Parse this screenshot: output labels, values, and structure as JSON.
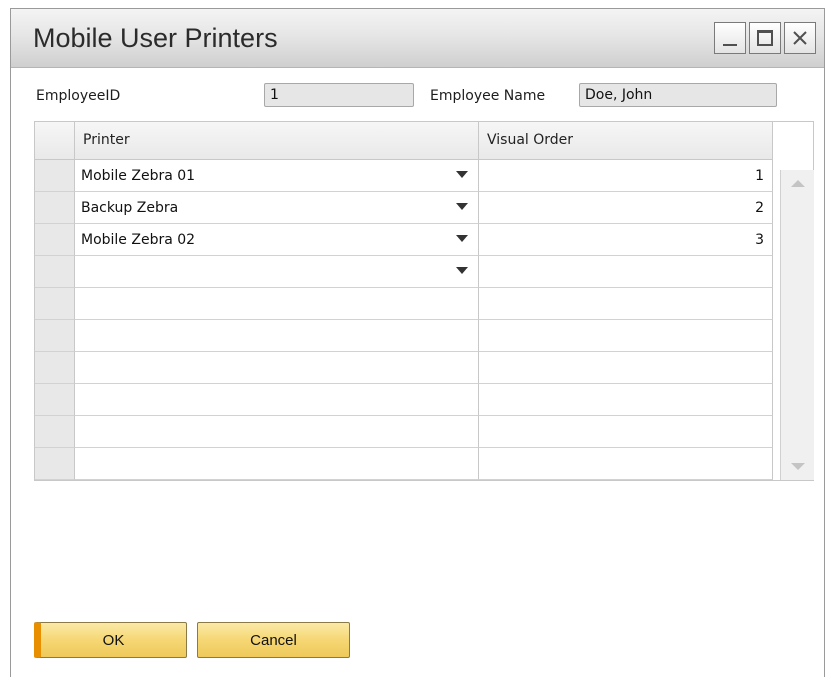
{
  "window": {
    "title": "Mobile User Printers",
    "controls": [
      "minimize-icon",
      "maximize-icon",
      "close-icon"
    ]
  },
  "fields": {
    "employee_id_label": "EmployeeID",
    "employee_id_value": "1",
    "employee_name_label": "Employee Name",
    "employee_name_value": "Doe, John"
  },
  "grid": {
    "columns": [
      "Printer",
      "Visual Order"
    ],
    "rows": [
      {
        "printer": "Mobile Zebra 01",
        "order": "1"
      },
      {
        "printer": "Backup Zebra",
        "order": "2"
      },
      {
        "printer": "Mobile Zebra 02",
        "order": "3"
      },
      {
        "printer": "",
        "order": ""
      },
      {
        "printer": "",
        "order": ""
      },
      {
        "printer": "",
        "order": ""
      },
      {
        "printer": "",
        "order": ""
      },
      {
        "printer": "",
        "order": ""
      },
      {
        "printer": "",
        "order": ""
      },
      {
        "printer": "",
        "order": ""
      }
    ]
  },
  "buttons": {
    "ok": "OK",
    "cancel": "Cancel"
  },
  "colors": {
    "button_face": "#f5d774",
    "default_button_accent": "#e88f00"
  }
}
